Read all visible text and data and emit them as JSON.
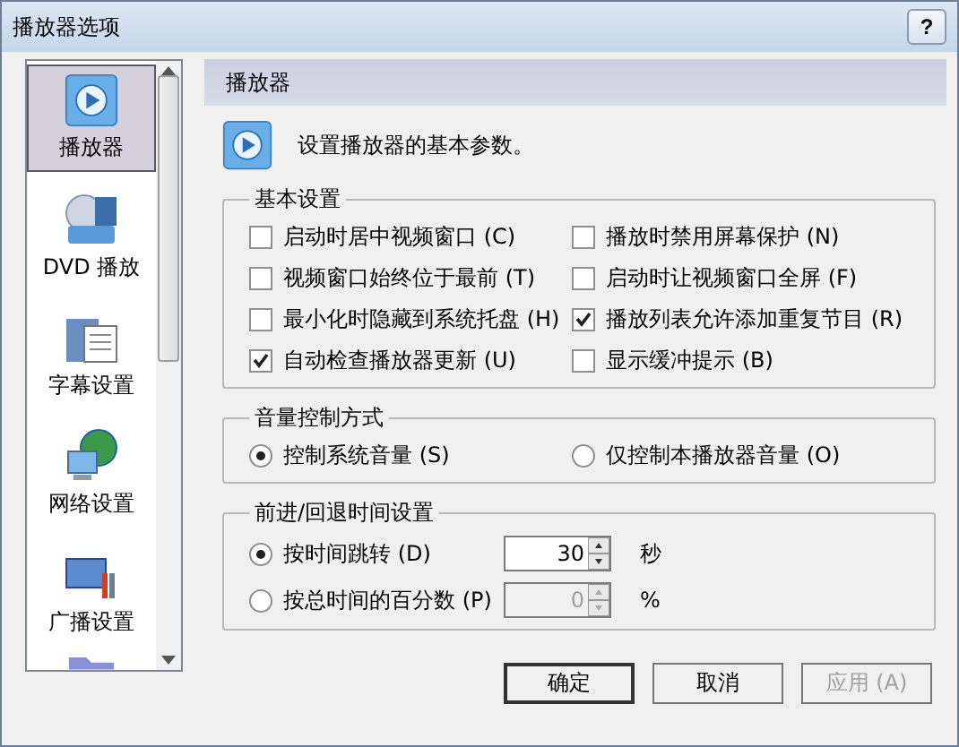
{
  "window": {
    "title": "播放器选项",
    "help": "?"
  },
  "sidebar": {
    "items": [
      {
        "label": "播放器",
        "kind": "player",
        "selected": true
      },
      {
        "label": "DVD 播放",
        "kind": "dvd",
        "selected": false
      },
      {
        "label": "字幕设置",
        "kind": "subtitle",
        "selected": false
      },
      {
        "label": "网络设置",
        "kind": "network",
        "selected": false
      },
      {
        "label": "广播设置",
        "kind": "broadcast",
        "selected": false
      }
    ]
  },
  "panel": {
    "title": "播放器",
    "description": "设置播放器的基本参数。"
  },
  "basic_settings": {
    "title": "基本设置",
    "options": [
      {
        "label": "启动时居中视频窗口 (C)",
        "checked": false
      },
      {
        "label": "播放时禁用屏幕保护 (N)",
        "checked": false
      },
      {
        "label": "视频窗口始终位于最前 (T)",
        "checked": false
      },
      {
        "label": "启动时让视频窗口全屏 (F)",
        "checked": false
      },
      {
        "label": "最小化时隐藏到系统托盘 (H)",
        "checked": false
      },
      {
        "label": "播放列表允许添加重复节目 (R)",
        "checked": true
      },
      {
        "label": "自动检查播放器更新 (U)",
        "checked": true
      },
      {
        "label": "显示缓冲提示 (B)",
        "checked": false
      }
    ]
  },
  "volume_control": {
    "title": "音量控制方式",
    "options": [
      {
        "label": "控制系统音量 (S)",
        "selected": true
      },
      {
        "label": "仅控制本播放器音量 (O)",
        "selected": false
      }
    ]
  },
  "seek_settings": {
    "title": "前进/回退时间设置",
    "options": [
      {
        "label": "按时间跳转 (D)",
        "selected": true,
        "value": "30",
        "unit": "秒",
        "disabled": false
      },
      {
        "label": "按总时间的百分数 (P)",
        "selected": false,
        "value": "0",
        "unit": "%",
        "disabled": true
      }
    ]
  },
  "buttons": [
    {
      "label": "确定",
      "disabled": false,
      "default": true
    },
    {
      "label": "取消",
      "disabled": false,
      "default": false
    },
    {
      "label": "应用 (A)",
      "disabled": true,
      "default": false
    }
  ]
}
